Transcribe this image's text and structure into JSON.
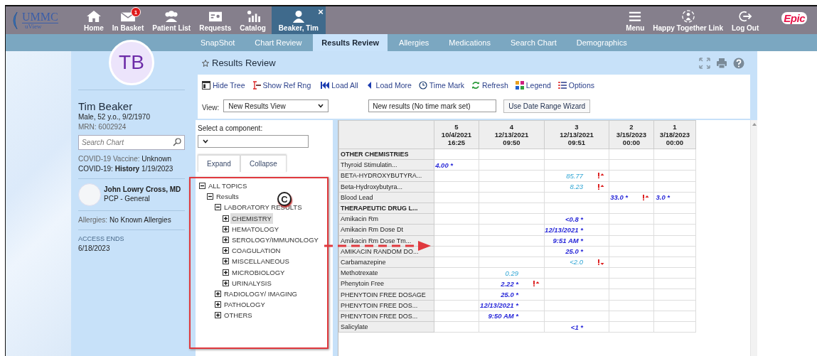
{
  "nav": {
    "logo": {
      "name": "UMMC",
      "sub": "uView"
    },
    "items": [
      {
        "label": "Home",
        "kind": "home"
      },
      {
        "label": "In Basket",
        "kind": "mail",
        "badge": "1"
      },
      {
        "label": "Patient List",
        "kind": "people"
      },
      {
        "label": "Requests",
        "kind": "card"
      },
      {
        "label": "Catalog",
        "kind": "bars"
      }
    ],
    "patient_tab": {
      "label": "Beaker, Tim",
      "close": "×",
      "selected": true
    },
    "right_items": [
      {
        "label": "Menu",
        "kind": "menu"
      },
      {
        "label": "Happy Together Link",
        "kind": "link"
      },
      {
        "label": "Log Out",
        "kind": "logout"
      }
    ],
    "brand": "Epic"
  },
  "tabs": [
    {
      "label": "SnapShot",
      "selected": false
    },
    {
      "label": "Chart Review",
      "selected": false
    },
    {
      "label": "Results Review",
      "selected": true
    },
    {
      "label": "Allergies",
      "selected": false
    },
    {
      "label": "Medications",
      "selected": false
    },
    {
      "label": "Search Chart",
      "selected": false
    },
    {
      "label": "Demographics",
      "selected": false
    }
  ],
  "patient": {
    "initials": "TB",
    "name": "Tim Beaker",
    "details": "Male, 52 y.o., 9/2/1970",
    "mrn_label": "MRN:",
    "mrn": "6002924",
    "search": {
      "placeholder": "Search Chart"
    },
    "facts": [
      {
        "label": "COVID-19 Vaccine:",
        "value": "Unknown",
        "strong_label": false
      },
      {
        "label": "COVID-19:",
        "value": "**History** 1/19/2023",
        "strong_label": true
      }
    ],
    "pcp": {
      "name": "John Lowry Cross, MD",
      "role": "PCP - General"
    },
    "allergies": {
      "label": "Allergies:",
      "value": "No Known Allergies"
    },
    "access": {
      "label": "ACCESS ENDS",
      "value": "6/18/2023"
    }
  },
  "results_review": {
    "title": "Results Review",
    "toolbar": [
      {
        "label": "Hide Tree",
        "kind": "hidetree"
      },
      {
        "label": "Show Ref Rng",
        "kind": "refrange"
      },
      {
        "label": "Load All",
        "kind": "loadall"
      },
      {
        "label": "Load More",
        "kind": "loadmore"
      },
      {
        "label": "Time Mark",
        "kind": "clock"
      },
      {
        "label": "Refresh",
        "kind": "refresh"
      },
      {
        "label": "Legend",
        "kind": "legend"
      },
      {
        "label": "Options",
        "kind": "options"
      }
    ],
    "view_label": "View:",
    "view_value": "New Results View",
    "time_mark_value": "New results (No time mark set)",
    "date_range_button": "Use Date Range Wizard"
  },
  "tree_panel": {
    "component_label": "Select a component:",
    "buttons": [
      "Expand",
      "Collapse"
    ],
    "tree": [
      {
        "label": "ALL TOPICS",
        "expanded": true,
        "selected": false,
        "children": [
          {
            "label": "Results",
            "expanded": true,
            "selected": false,
            "children": [
              {
                "label": "LABORATORY RESULTS",
                "expanded": true,
                "selected": false,
                "children": [
                  {
                    "label": "CHEMISTRY",
                    "expanded": false,
                    "selected": true
                  },
                  {
                    "label": "HEMATOLOGY",
                    "expanded": false,
                    "selected": false
                  },
                  {
                    "label": "SEROLOGY/IMMUNOLOGY",
                    "expanded": false,
                    "selected": false
                  },
                  {
                    "label": "COAGULATION",
                    "expanded": false,
                    "selected": false
                  },
                  {
                    "label": "MISCELLANEOUS",
                    "expanded": false,
                    "selected": false
                  },
                  {
                    "label": "MICROBIOLOGY",
                    "expanded": false,
                    "selected": false
                  },
                  {
                    "label": "URINALYSIS",
                    "expanded": false,
                    "selected": false
                  }
                ]
              },
              {
                "label": "RADIOLOGY/ IMAGING",
                "expanded": false,
                "selected": false
              },
              {
                "label": "PATHOLOGY",
                "expanded": false,
                "selected": false
              },
              {
                "label": "OTHERS",
                "expanded": false,
                "selected": false
              }
            ]
          }
        ]
      }
    ]
  },
  "table": {
    "columns": [
      {
        "number": "5",
        "date": "10/4/2021",
        "time": "16:25"
      },
      {
        "number": "4",
        "date": "12/13/2021",
        "time": "09:50"
      },
      {
        "number": "3",
        "date": "12/13/2021",
        "time": "09:51"
      },
      {
        "number": "2",
        "date": "3/15/2023",
        "time": "00:00"
      },
      {
        "number": "1",
        "date": "3/18/2023",
        "time": "00:00"
      }
    ],
    "rows": [
      {
        "name": "OTHER CHEMISTRIES",
        "kind": "section",
        "cells": [
          null,
          null,
          null,
          null,
          null
        ]
      },
      {
        "name": "Thyroid Stimulatin...",
        "kind": "result",
        "cells": [
          {
            "value": "4.00 *",
            "kind": "new"
          },
          null,
          null,
          null,
          null
        ]
      },
      {
        "name": "BETA-HYDROXYBUTYRA...",
        "kind": "result",
        "cells": [
          null,
          null,
          {
            "value": "85.77",
            "kind": "prior",
            "high": true
          },
          null,
          null
        ]
      },
      {
        "name": "Beta-Hydroxybutyra...",
        "kind": "result",
        "cells": [
          null,
          null,
          {
            "value": "8.23",
            "kind": "prior",
            "high": true
          },
          null,
          null
        ]
      },
      {
        "name": "Blood Lead",
        "kind": "result",
        "cells": [
          null,
          null,
          null,
          {
            "value": "33.0 *",
            "kind": "new",
            "high": true
          },
          {
            "value": "3.0 *",
            "kind": "new"
          }
        ]
      },
      {
        "name": "THERAPEUTIC DRUG L...",
        "kind": "section",
        "cells": [
          null,
          null,
          null,
          null,
          null
        ]
      },
      {
        "name": "Amikacin Rm",
        "kind": "result",
        "cells": [
          null,
          null,
          {
            "value": "<0.8 *",
            "kind": "new"
          },
          null,
          null
        ]
      },
      {
        "name": "Amikacin Rm Dose Dt",
        "kind": "result",
        "cells": [
          null,
          null,
          {
            "value": "12/13/2021 *",
            "kind": "new"
          },
          null,
          null
        ]
      },
      {
        "name": "Amikacin Rm Dose Tm...",
        "kind": "result",
        "cells": [
          null,
          null,
          {
            "value": "9:51 AM *",
            "kind": "new"
          },
          null,
          null
        ]
      },
      {
        "name": "AMIKACIN RANDOM DO...",
        "kind": "result",
        "cells": [
          null,
          null,
          {
            "value": "25.0 *",
            "kind": "new"
          },
          null,
          null
        ]
      },
      {
        "name": "Carbamazepine",
        "kind": "result",
        "cells": [
          null,
          null,
          {
            "value": "<2.0",
            "kind": "prior",
            "low": true
          },
          null,
          null
        ]
      },
      {
        "name": "Methotrexate",
        "kind": "result",
        "cells": [
          null,
          {
            "value": "0.29",
            "kind": "prior"
          },
          null,
          null,
          null
        ]
      },
      {
        "name": "Phenytoin Free",
        "kind": "result",
        "cells": [
          null,
          {
            "value": "2.22 *",
            "kind": "new",
            "high": true
          },
          null,
          null,
          null
        ]
      },
      {
        "name": "PHENYTOIN FREE DOSAGE",
        "kind": "result",
        "cells": [
          null,
          {
            "value": "25.0 *",
            "kind": "new"
          },
          null,
          null,
          null
        ]
      },
      {
        "name": "PHENYTOIN FREE DOS...",
        "kind": "result",
        "cells": [
          null,
          {
            "value": "12/13/2021 *",
            "kind": "new"
          },
          null,
          null,
          null
        ]
      },
      {
        "name": "PHENYTOIN FREE DOS...",
        "kind": "result",
        "cells": [
          null,
          {
            "value": "9:50 AM *",
            "kind": "new"
          },
          null,
          null,
          null
        ]
      },
      {
        "name": "Salicylate",
        "kind": "result",
        "cells": [
          null,
          null,
          {
            "value": "<1 *",
            "kind": "new"
          },
          null,
          null
        ]
      }
    ]
  },
  "annotations": {
    "step_label": "C"
  }
}
